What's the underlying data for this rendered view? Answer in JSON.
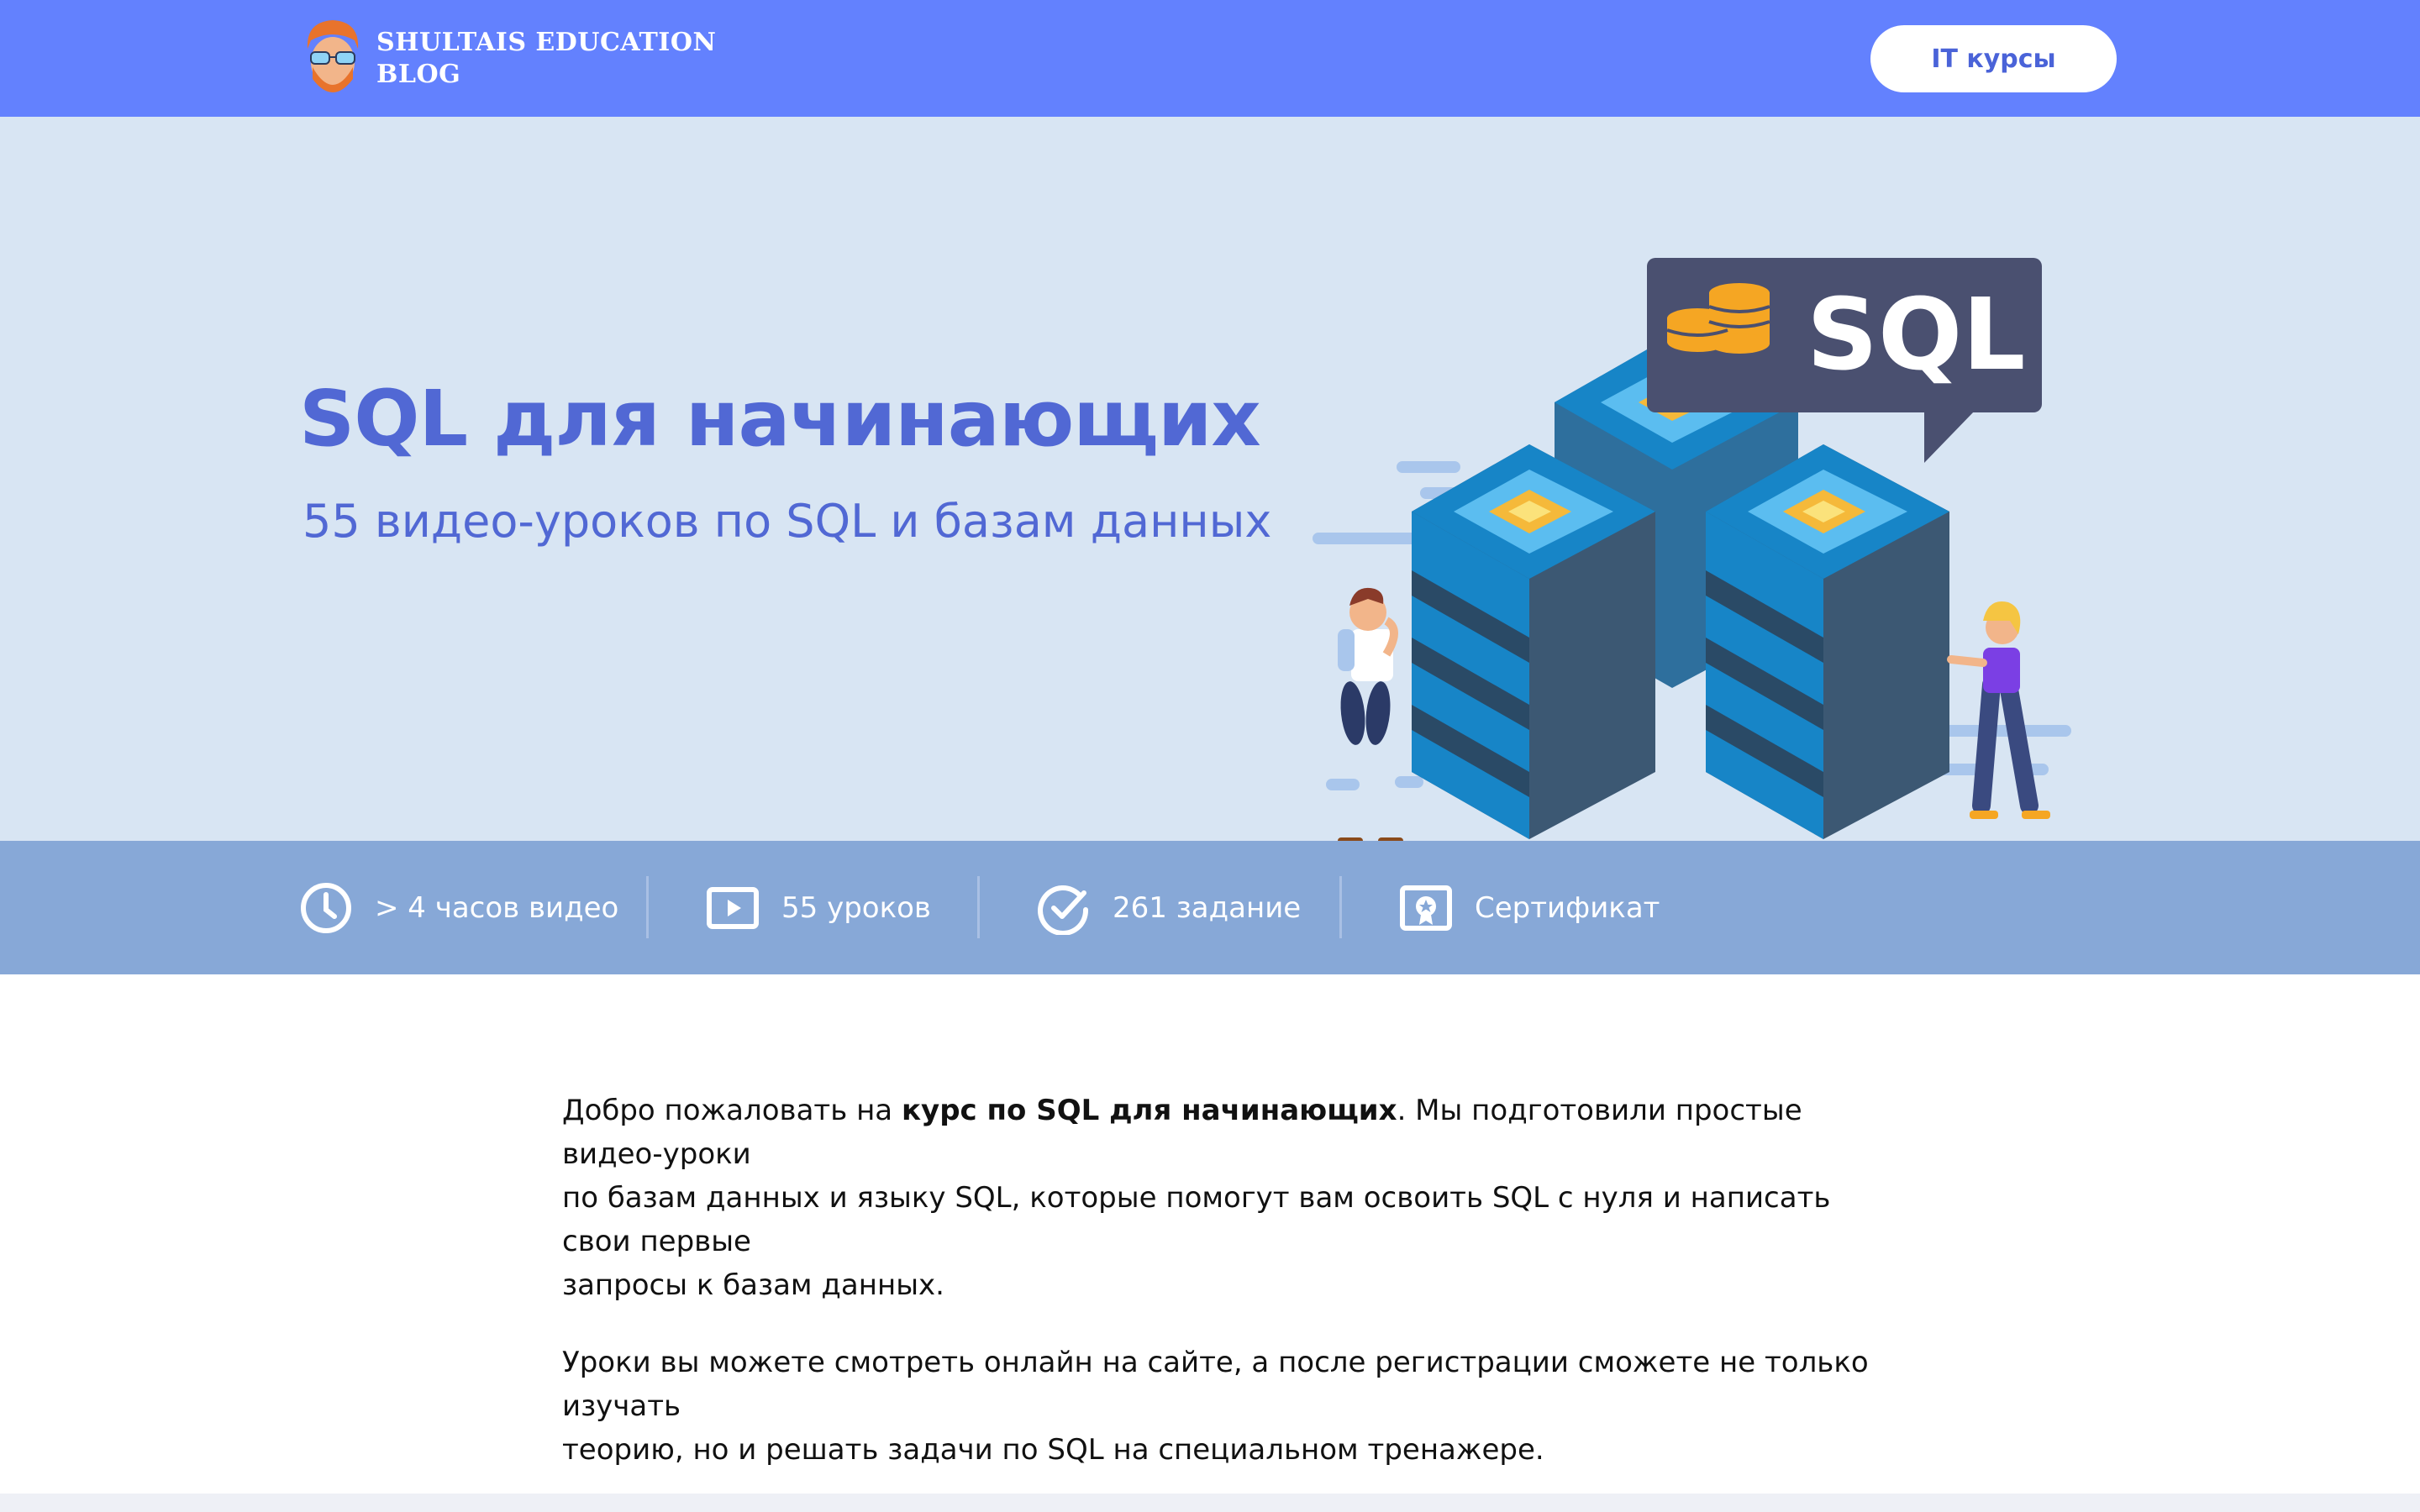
{
  "header": {
    "logo_line1": "SHULTAIS EDUCATION",
    "logo_line2": "BLOG",
    "it_button_label": "IT курсы"
  },
  "hero": {
    "title": "SQL для начинающих",
    "subtitle": "55 видео-уроков по SQL и базам данных",
    "illustration_badge_text": "SQL"
  },
  "features": [
    {
      "icon": "clock-icon",
      "label": "> 4 часов видео"
    },
    {
      "icon": "video-play-icon",
      "label": "55 уроков"
    },
    {
      "icon": "check-circle-icon",
      "label": "261 задание"
    },
    {
      "icon": "certificate-icon",
      "label": "Сертификат"
    }
  ],
  "content": {
    "p1_before": "Добро пожаловать на ",
    "p1_bold": "курс по SQL для начинающих",
    "p1_after_line1": ". Мы подготовили простые видео-уроки",
    "p1_line2": "по базам данных и языку SQL, которые помогут вам освоить SQL с нуля и написать свои первые",
    "p1_line3": "запросы к базам данных.",
    "p2_line1": "Уроки вы можете смотреть онлайн на сайте, а после регистрации сможете не только изучать",
    "p2_line2": "теорию, но и решать задачи по SQL на специальном тренажере."
  },
  "colors": {
    "header_bg": "#6381fe",
    "hero_bg": "#d8e5f3",
    "accent_text": "#5168d4",
    "features_bg": "#87a8d7"
  }
}
